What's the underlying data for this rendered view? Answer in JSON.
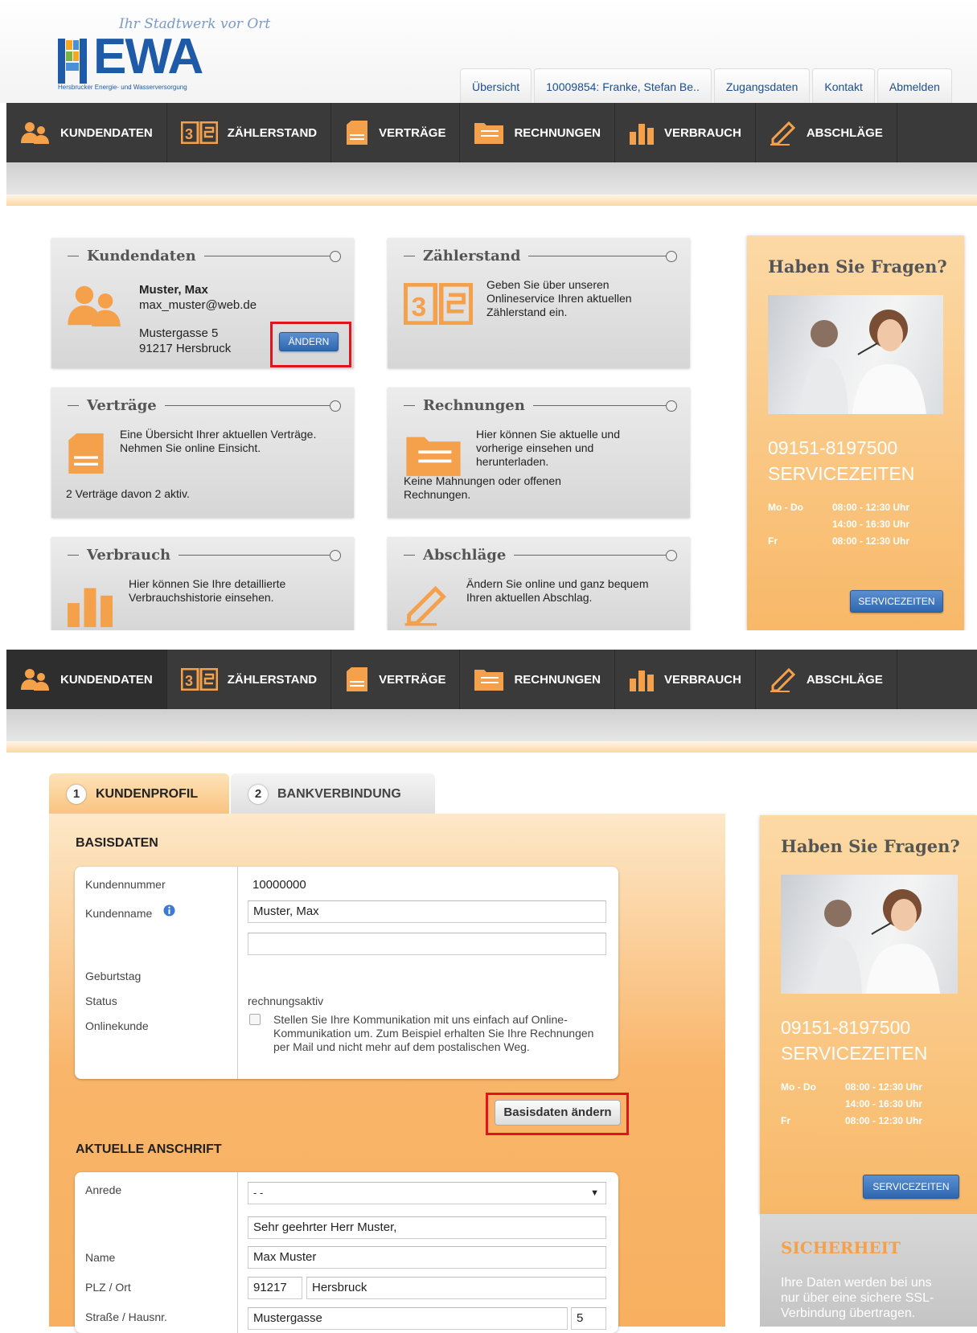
{
  "header": {
    "slogan": "Ihr Stadtwerk vor Ort",
    "logo_text": "EWA",
    "logo_sub": "Hersbrucker Energie- und Wasserversorgung",
    "topnav": [
      "Übersicht",
      "10009854: Franke, Stefan Be..",
      "Zugangsdaten",
      "Kontakt",
      "Abmelden"
    ]
  },
  "menu": [
    "KUNDENDATEN",
    "ZÄHLERSTAND",
    "VERTRÄGE",
    "RECHNUNGEN",
    "VERBRAUCH",
    "ABSCHLÄGE"
  ],
  "cards": {
    "kundendaten": {
      "title": "Kundendaten",
      "name": "Muster, Max",
      "email": "max_muster@web.de",
      "street": "Mustergasse 5",
      "city": "91217 Hersbruck",
      "button": "ÄNDERN"
    },
    "zaehlerstand": {
      "title": "Zählerstand",
      "text": "Geben Sie über unseren Onlineservice Ihren aktuellen Zählerstand ein."
    },
    "vertraege": {
      "title": "Verträge",
      "text": "Eine Übersicht Ihrer aktuellen Verträge. Nehmen Sie online Einsicht.",
      "footer": "2 Verträge davon 2 aktiv."
    },
    "rechnungen": {
      "title": "Rechnungen",
      "text": "Hier können Sie aktuelle und vorherige einsehen und herunterladen.",
      "footer": "Keine Mahnungen oder offenen Rechnungen."
    },
    "verbrauch": {
      "title": "Verbrauch",
      "text": "Hier können Sie Ihre detaillierte Verbrauchshistorie einsehen."
    },
    "abschlaege": {
      "title": "Abschläge",
      "text": "Ändern Sie online und ganz bequem Ihren aktuellen Abschlag."
    }
  },
  "sidebar": {
    "title": "Haben Sie Fragen?",
    "phone": "09151-8197500",
    "service_heading": "SERVICEZEITEN",
    "hours": [
      {
        "day": "Mo - Do",
        "time": "08:00 - 12:30 Uhr"
      },
      {
        "day": "",
        "time": "14:00 - 16:30 Uhr"
      },
      {
        "day": "Fr",
        "time": "08:00 - 12:30 Uhr"
      }
    ],
    "button": "SERVICEZEITEN",
    "security_title": "SICHERHEIT",
    "security_text": "Ihre Daten werden bei uns nur über eine sichere SSL-Verbindung übertragen."
  },
  "tabs": [
    {
      "num": "1",
      "label": "KUNDENPROFIL"
    },
    {
      "num": "2",
      "label": "BANKVERBINDUNG"
    }
  ],
  "basisdaten": {
    "heading": "BASISDATEN",
    "kundennummer_label": "Kundennummer",
    "kundennummer": "10000000",
    "kundenname_label": "Kundenname",
    "kundenname": "Muster, Max",
    "kundenname2": "",
    "geburtstag_label": "Geburtstag",
    "status_label": "Status",
    "status": "rechnungsaktiv",
    "onlinekunde_label": "Onlinekunde",
    "onlinekunde_text": "Stellen Sie Ihre Kommunikation mit uns einfach auf Online-Kommunikation um. Zum Beispiel erhalten Sie Ihre Rechnungen per Mail und nicht mehr auf dem postalischen Weg.",
    "onlinekunde_checked": false,
    "button": "Basisdaten ändern"
  },
  "anschrift": {
    "heading": "AKTUELLE ANSCHRIFT",
    "anrede_label": "Anrede",
    "anrede": "- -",
    "briefanrede": "Sehr geehrter Herr Muster,",
    "name_label": "Name",
    "name": "Max Muster",
    "plz_label": "PLZ / Ort",
    "plz": "91217",
    "ort": "Hersbruck",
    "strasse_label": "Straße / Hausnr.",
    "strasse": "Mustergasse",
    "hausnr": "5"
  }
}
